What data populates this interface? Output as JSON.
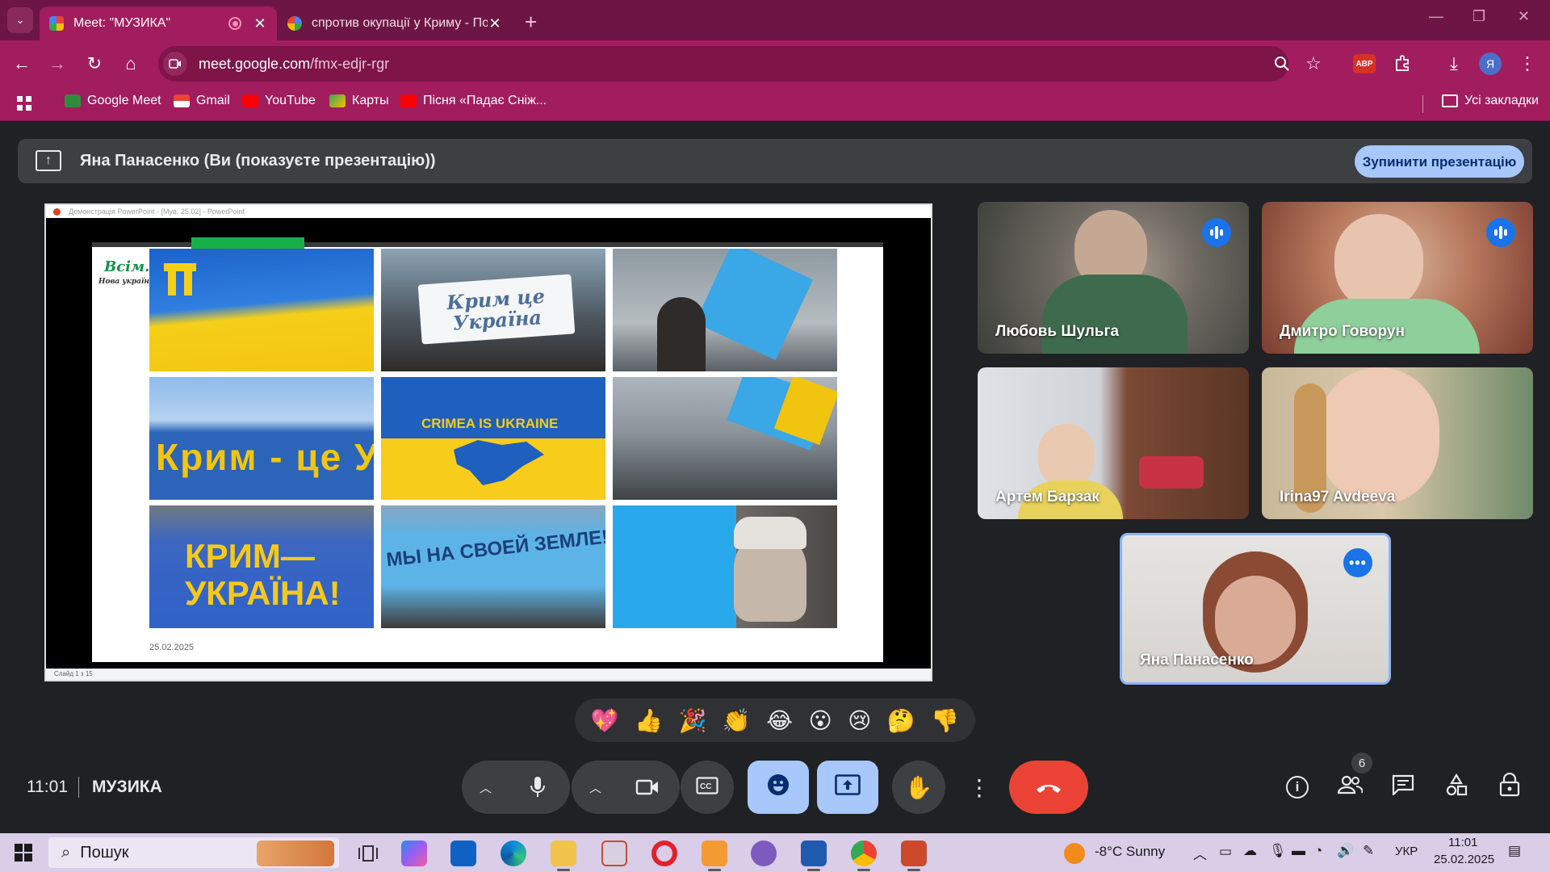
{
  "browser": {
    "tabs": [
      {
        "title": "Meet: \"МУЗИКА\"",
        "active": true
      },
      {
        "title": "спротив окупації у Криму - По",
        "active": false
      }
    ],
    "new_tab_label": "+",
    "url_host": "meet.google.com",
    "url_path": "/fmx-edjr-rgr",
    "extension_badge": "ABP",
    "profile_initial": "Я",
    "bookmarks": [
      {
        "label": "Google Meet",
        "color": "#2d8c3c"
      },
      {
        "label": "Gmail",
        "color": "#ea4335"
      },
      {
        "label": "YouTube",
        "color": "#ff0000"
      },
      {
        "label": "Карты",
        "color": "#34a853"
      },
      {
        "label": "Пісня «Падає Сніж...",
        "color": "#ff0000"
      }
    ],
    "all_bookmarks_label": "Усі закладки"
  },
  "meet": {
    "presenting_banner": "Яна Панасенко (Ви (показуєте презентацію))",
    "stop_button": "Зупинити презентацію",
    "presentation": {
      "window_title": "Демонстрація PowerPoint - [Мув. 25.02] - PowerPoint",
      "slide_status": "Слайд 1 з 15",
      "logo_text": "Всім.",
      "logo_subtext": "Нова українська",
      "slide_date": "25.02.2025",
      "photo_captions": [
        "",
        "Крим це Україна",
        "",
        "Крим - це Україна",
        "CRIMEA IS UKRAINE",
        "",
        "КРИМ— УКРАЇНА!",
        "МЫ НА СВОЕЙ ЗЕМЛЕ!",
        ""
      ]
    },
    "participants": [
      {
        "name": "Любовь Шульга",
        "speaking": true
      },
      {
        "name": "Дмитро Говорун",
        "speaking": true
      },
      {
        "name": "Артем Барзак",
        "speaking": false
      },
      {
        "name": "Irina97 Avdeeva",
        "speaking": false
      },
      {
        "name": "Яна Панасенко",
        "speaking": false,
        "self": true
      }
    ],
    "reactions": [
      "💖",
      "👍",
      "🎉",
      "👏",
      "😂",
      "😮",
      "😢",
      "🤔",
      "👎"
    ],
    "meeting_time": "11:01",
    "meeting_name": "МУЗИКА",
    "people_count": "6",
    "icons": {
      "mic": "mic-icon",
      "camera": "camera-icon",
      "captions": "captions-icon",
      "emoji": "emoji-icon",
      "present": "present-icon",
      "hand": "raise-hand-icon",
      "more": "more-icon",
      "end": "end-call-icon",
      "info": "info-icon",
      "people": "people-icon",
      "chat": "chat-icon",
      "activities": "activities-icon",
      "lock": "host-controls-icon"
    }
  },
  "taskbar": {
    "search_placeholder": "Пошук",
    "weather": "-8°C Sunny",
    "language": "УКР",
    "time": "11:01",
    "date": "25.02.2025"
  },
  "colors": {
    "tabstrip": "#6d1645",
    "toolbar": "#a11d5e",
    "meet_bg": "#202124",
    "accent_blue": "#a8c7fa",
    "end_call": "#ea4335",
    "taskbar": "#d9cde8"
  }
}
